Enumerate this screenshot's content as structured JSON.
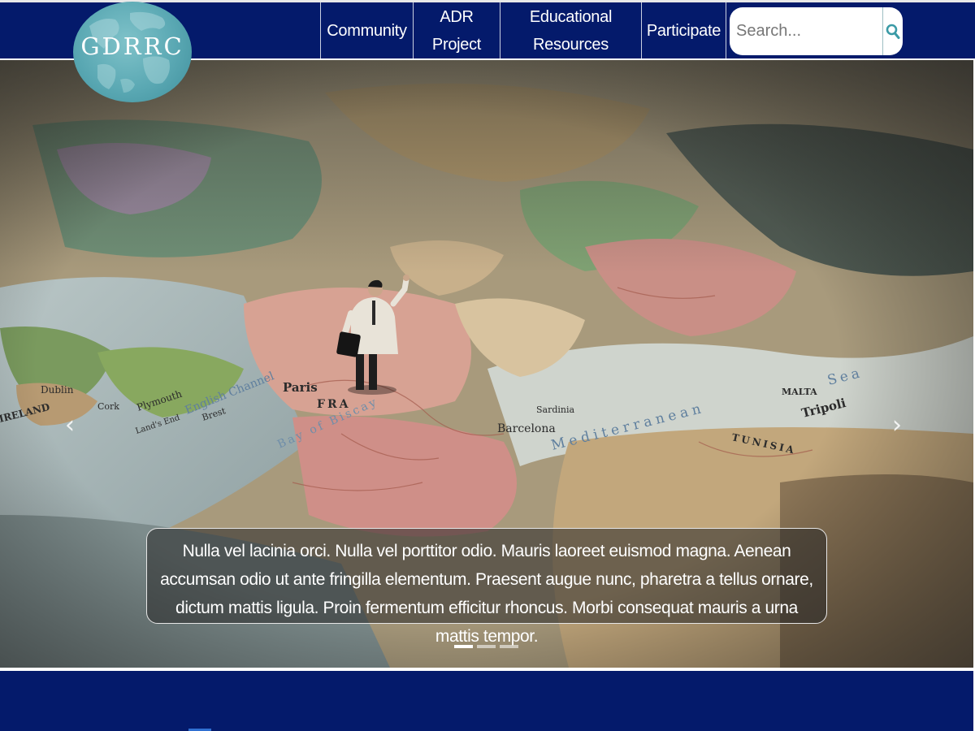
{
  "header": {
    "logo_text": "GDRRC",
    "nav": {
      "community": "Community",
      "adr_line1": "ADR",
      "adr_line2": "Project",
      "edu_line1": "Educational",
      "edu_line2": "Resources",
      "participate": "Participate"
    },
    "search": {
      "placeholder": "Search...",
      "button_icon": "search-icon"
    }
  },
  "carousel": {
    "caption": "Nulla vel lacinia orci. Nulla vel porttitor odio. Mauris laoreet euismod magna. Aenean accumsan odio ut ante fringilla elementum. Praesent augue nunc, pharetra a tellus ornare, dictum mattis ligula. Proin fermentum efficitur rhoncus. Morbi consequat mauris a urna mattis tempor.",
    "prev_icon": "chevron-left-icon",
    "next_icon": "chevron-right-icon",
    "slide_count": 3,
    "active_slide": 1,
    "map_labels": {
      "paris": "Paris",
      "france": "FRA",
      "barcelona": "Barcelona",
      "mediterranean": "Mediterranean",
      "sea": "Sea",
      "tunisia": "TUNISIA",
      "tripoli": "Tripoli",
      "english_channel": "English Channel",
      "bay_of_biscay": "Bay of Biscay",
      "ireland": "IRELAND",
      "dublin": "Dublin",
      "cork": "Cork",
      "plymouth": "Plymouth",
      "sardinia": "Sardinia",
      "malta": "MALTA",
      "lands_end": "Land's End",
      "brest": "Brest"
    }
  },
  "colors": {
    "header_bg": "#041a6b",
    "logo_globe": "#5aa8b3",
    "accent": "#3a9aa6"
  }
}
